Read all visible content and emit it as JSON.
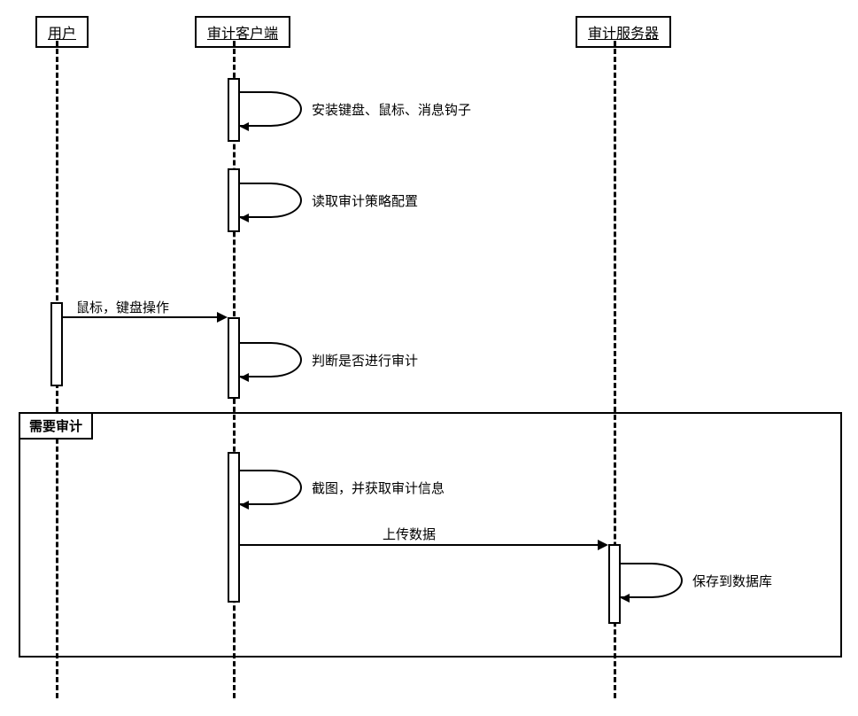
{
  "participants": {
    "user": "用户",
    "client": "审计客户端",
    "server": "审计服务器"
  },
  "messages": {
    "install_hooks": "安装键盘、鼠标、消息钩子",
    "read_policy": "读取审计策略配置",
    "mouse_keyboard": "鼠标，键盘操作",
    "judge_audit": "判断是否进行审计",
    "screenshot": "截图，并获取审计信息",
    "upload": "上传数据",
    "save_db": "保存到数据库"
  },
  "fragment": {
    "need_audit": "需要审计"
  },
  "chart_data": {
    "type": "sequence_diagram",
    "participants": [
      "用户",
      "审计客户端",
      "审计服务器"
    ],
    "interactions": [
      {
        "from": "审计客户端",
        "to": "审计客户端",
        "label": "安装键盘、鼠标、消息钩子",
        "type": "self"
      },
      {
        "from": "审计客户端",
        "to": "审计客户端",
        "label": "读取审计策略配置",
        "type": "self"
      },
      {
        "from": "用户",
        "to": "审计客户端",
        "label": "鼠标，键盘操作",
        "type": "sync"
      },
      {
        "from": "审计客户端",
        "to": "审计客户端",
        "label": "判断是否进行审计",
        "type": "self"
      },
      {
        "fragment": "需要审计",
        "contains": [
          {
            "from": "审计客户端",
            "to": "审计客户端",
            "label": "截图，并获取审计信息",
            "type": "self"
          },
          {
            "from": "审计客户端",
            "to": "审计服务器",
            "label": "上传数据",
            "type": "sync"
          },
          {
            "from": "审计服务器",
            "to": "审计服务器",
            "label": "保存到数据库",
            "type": "self"
          }
        ]
      }
    ]
  }
}
